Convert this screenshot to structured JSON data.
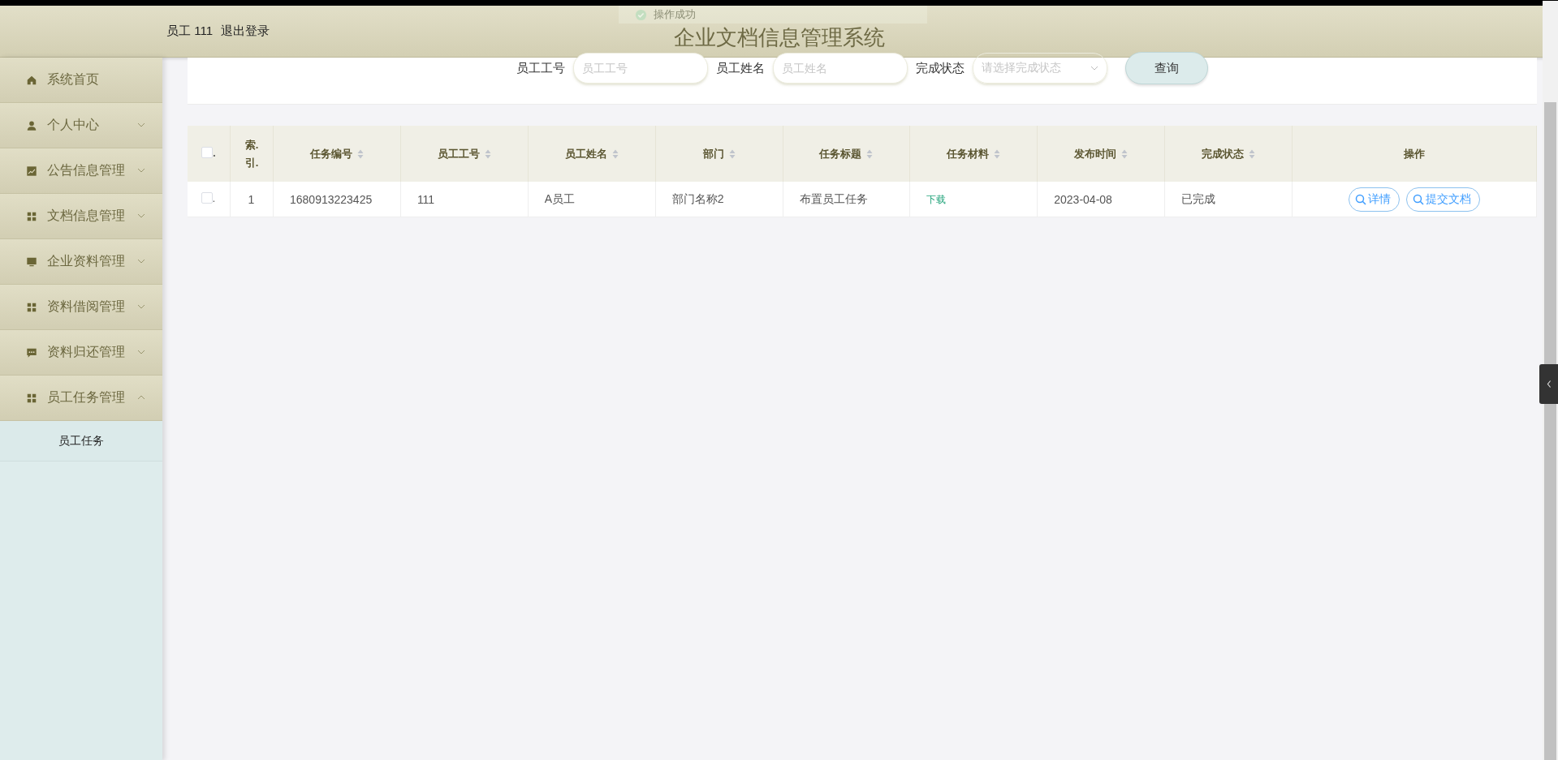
{
  "toast": {
    "text": "操作成功"
  },
  "header": {
    "user": "员工 111",
    "logout": "退出登录",
    "title": "企业文档信息管理系统"
  },
  "sidebar": {
    "items": [
      {
        "label": "系统首页",
        "kind": "home"
      },
      {
        "label": "个人中心",
        "kind": "person",
        "expanded": false
      },
      {
        "label": "公告信息管理",
        "kind": "chart",
        "expanded": false
      },
      {
        "label": "文档信息管理",
        "kind": "grid",
        "expanded": false
      },
      {
        "label": "企业资料管理",
        "kind": "monitor",
        "expanded": false
      },
      {
        "label": "资料借阅管理",
        "kind": "grid",
        "expanded": false
      },
      {
        "label": "资料归还管理",
        "kind": "chat",
        "expanded": false
      },
      {
        "label": "员工任务管理",
        "kind": "grid",
        "expanded": true,
        "children": [
          {
            "label": "员工任务",
            "selected": true
          }
        ]
      }
    ]
  },
  "search": {
    "fields": [
      {
        "label": "员工工号",
        "placeholder": "员工工号",
        "kind": "input"
      },
      {
        "label": "员工姓名",
        "placeholder": "员工姓名",
        "kind": "input"
      },
      {
        "label": "完成状态",
        "placeholder": "请选择完成状态",
        "kind": "select"
      }
    ],
    "button": "查询"
  },
  "table": {
    "select_all": {
      "label": ".",
      "checked": false
    },
    "columns": [
      {
        "kind": "index",
        "label": "索.引."
      },
      {
        "kind": "text",
        "label": "任务编号",
        "sortable": true
      },
      {
        "kind": "text",
        "label": "员工工号",
        "sortable": true
      },
      {
        "kind": "text",
        "label": "员工姓名",
        "sortable": true
      },
      {
        "kind": "text",
        "label": "部门",
        "sortable": true
      },
      {
        "kind": "text",
        "label": "任务标题",
        "sortable": true
      },
      {
        "kind": "link",
        "label": "任务材料",
        "sortable": true
      },
      {
        "kind": "text",
        "label": "发布时间",
        "sortable": true
      },
      {
        "kind": "text",
        "label": "完成状态",
        "sortable": true
      },
      {
        "kind": "actions",
        "label": "操作"
      }
    ],
    "rows": [
      {
        "checked": false,
        "check_label": ".",
        "cells": [
          "1",
          "1680913223425",
          "111",
          "A员工",
          "部门名称2",
          "布置员工任务",
          "下载",
          "2023-04-08",
          "已完成"
        ],
        "actions": [
          "详情",
          "提交文档"
        ]
      }
    ]
  }
}
